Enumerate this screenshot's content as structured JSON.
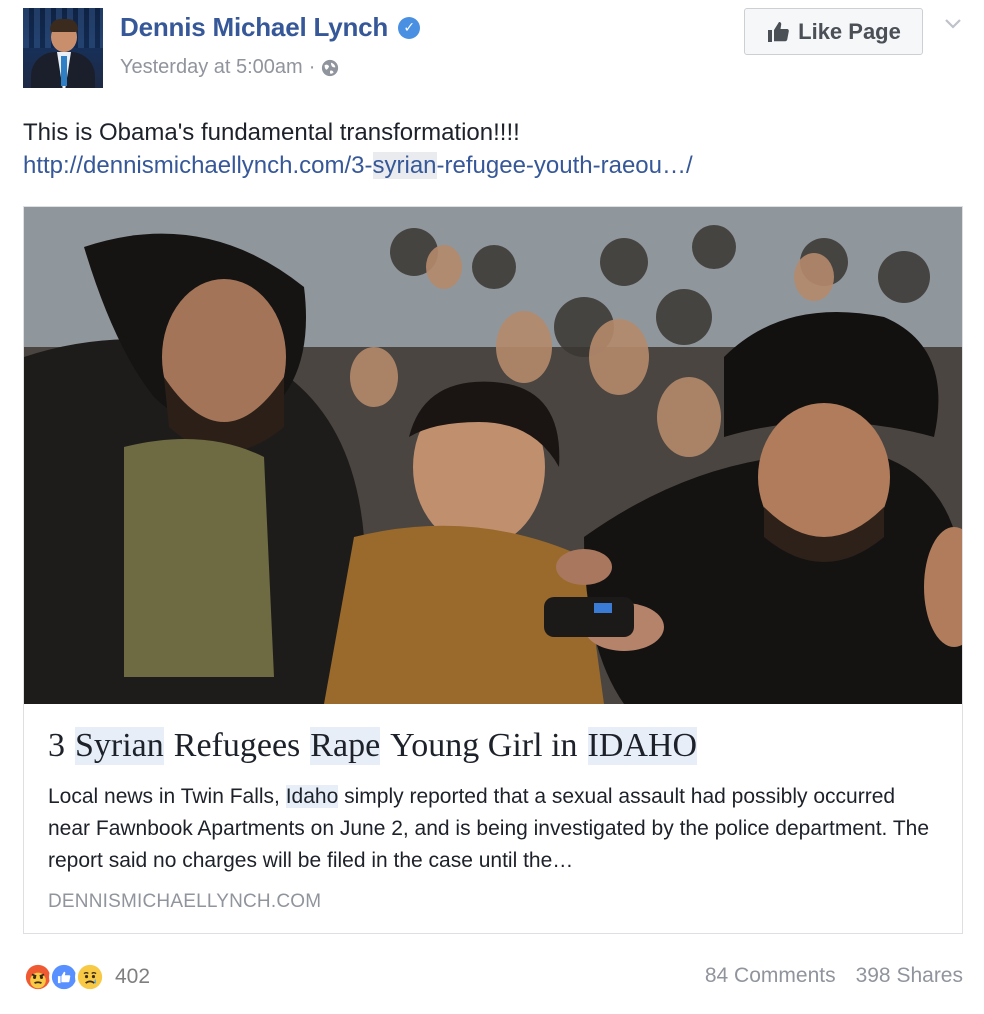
{
  "header": {
    "page_name": "Dennis Michael Lynch",
    "timestamp": "Yesterday at 5:00am",
    "separator": "·",
    "like_page_label": "Like Page"
  },
  "post": {
    "text": "This is Obama's fundamental transformation!!!!",
    "link_part1": "http://dennismichaellynch.com/3-",
    "link_highlight": "syrian",
    "link_part2": "-refugee-youth-raeou…/"
  },
  "card": {
    "title_parts": [
      "3",
      "Syrian",
      "Refugees",
      "Rape",
      "Young Girl in",
      "IDAHO"
    ],
    "description_part1": "Local news in Twin Falls, ",
    "description_highlight": "Idaho",
    "description_part2": " simply reported that a sexual assault had possibly occurred near Fawnbook Apartments on June 2, and is being investigated by the police department. The report said no charges will be filed in the case until the…",
    "domain": "DENNISMICHAELLYNCH.COM"
  },
  "footer": {
    "reactions": [
      "angry-reaction-icon",
      "like-reaction-icon",
      "sad-reaction-icon"
    ],
    "reaction_count": "402",
    "comments": "84 Comments",
    "shares": "398 Shares"
  },
  "colors": {
    "link_blue": "#365899",
    "meta_gray": "#90949c",
    "verified_blue": "#4a90e2",
    "like_blue": "#5890ff",
    "angry_orange": "#f05a32",
    "sad_yellow": "#f7c944"
  }
}
